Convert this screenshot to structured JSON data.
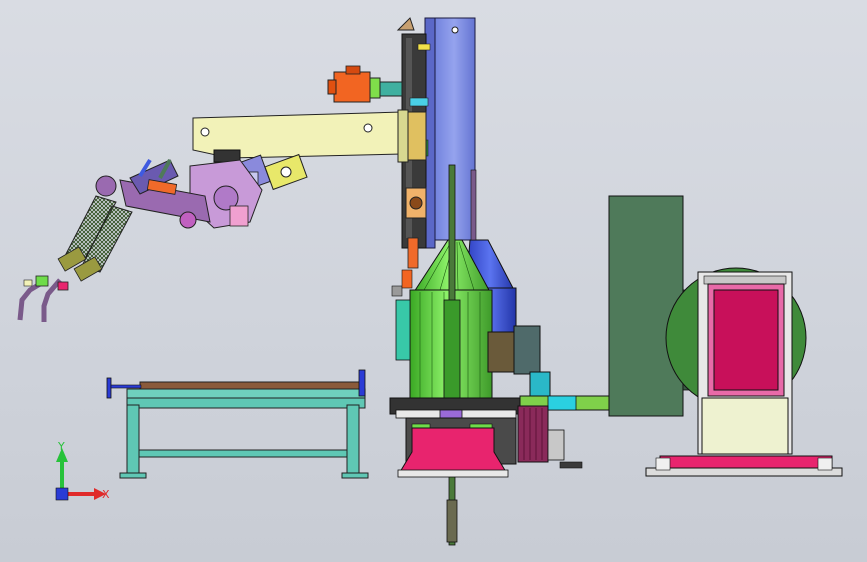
{
  "viewport": {
    "background_top": "#d9dce3",
    "background_bottom": "#c8ccd4"
  },
  "coordinate_triad": {
    "y_label": "Y",
    "x_label": "X",
    "y_color": "#27c23a",
    "x_color": "#e02a2a",
    "origin_color": "#2a3bd6"
  },
  "colors": {
    "column_blue": "#7f8fe6",
    "boom_yellow": "#f2f2b8",
    "motor_orange": "#f26522",
    "green_hopper": "#6fdc4a",
    "blue_cone": "#3f5ae0",
    "pink_base": "#e8246e",
    "cabinet_green": "#4f7a5a",
    "positioner_pink": "#c8105a",
    "table_teal": "#5fc7b4",
    "table_top_brown": "#8a5a3a",
    "robot_purple": "#9a6ab0"
  }
}
